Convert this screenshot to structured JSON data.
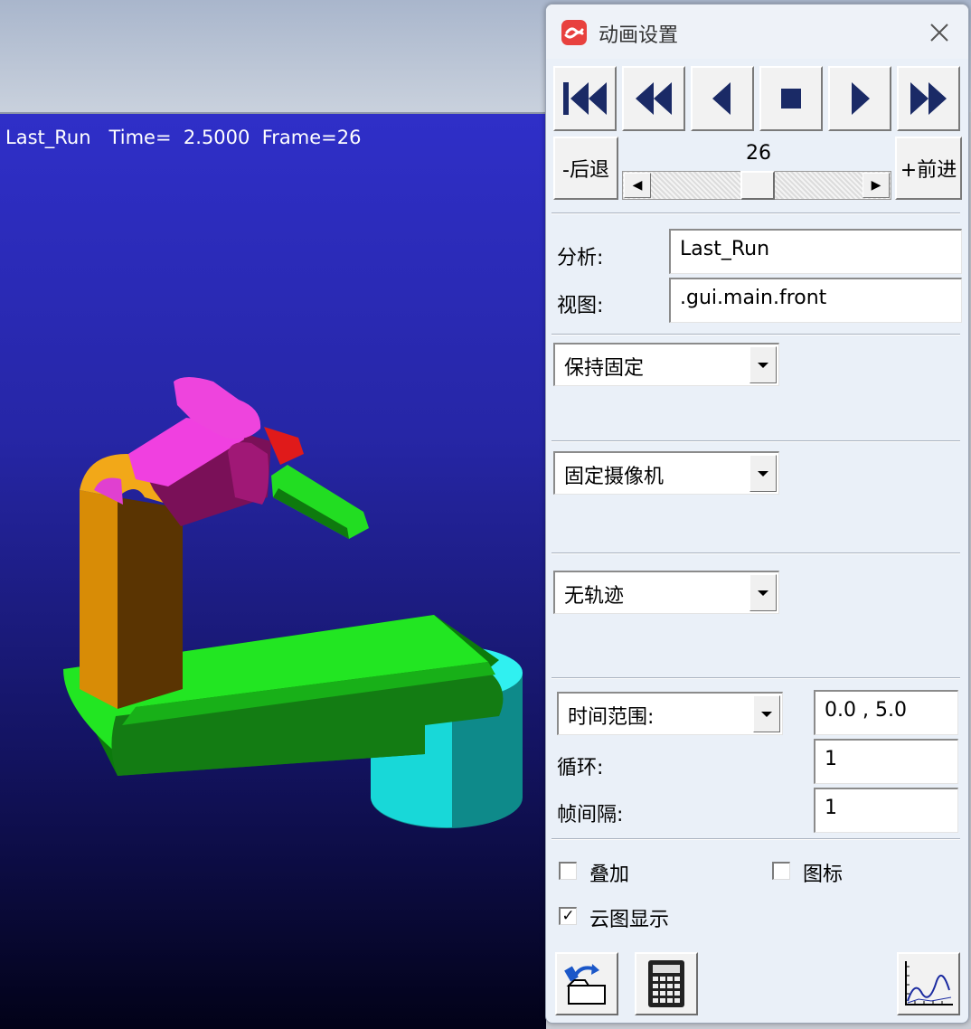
{
  "viewport": {
    "run_label": "Last_Run",
    "time_label": "Time=",
    "time_value": "2.5000",
    "frame_label": "Frame=26"
  },
  "dialog": {
    "title": "动画设置",
    "transport": [
      "rewind-to-start",
      "step-backward-fast",
      "play-reverse",
      "stop",
      "play-forward",
      "fast-forward"
    ],
    "step_back_label": "-后退",
    "step_forward_label": "+前进",
    "frame_value": "26",
    "analysis_label": "分析:",
    "analysis_value": "Last_Run",
    "view_label": "视图:",
    "view_value": ".gui.main.front",
    "fixed_select": "保持固定",
    "camera_select": "固定摄像机",
    "trace_select": "无轨迹",
    "time_range_select": "时间范围:",
    "time_range_value": "0.0 , 5.0",
    "loop_label": "循环:",
    "loop_value": "1",
    "frame_interval_label": "帧间隔:",
    "frame_interval_value": "1",
    "overlay_label": "叠加",
    "overlay_checked": false,
    "icons_label": "图标",
    "icons_checked": false,
    "contour_label": "云图显示",
    "contour_checked": true,
    "contour_mark": "✓"
  },
  "colors": {
    "pink": "#ee44dd",
    "green": "#22dd22",
    "orange": "#ee9a08",
    "cyan": "#11e6e6",
    "red": "#ee2222"
  }
}
